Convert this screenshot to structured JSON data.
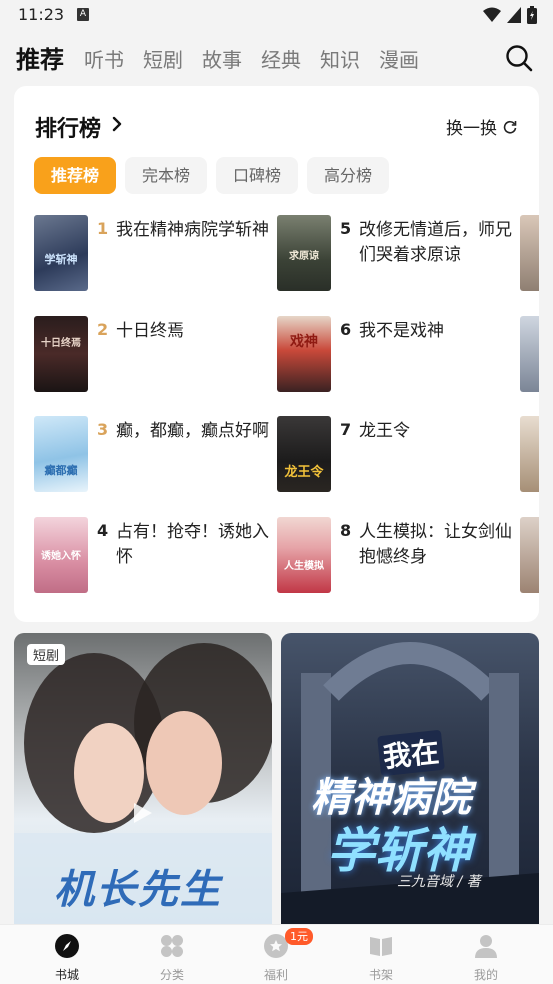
{
  "status_bar": {
    "time": "11:23",
    "notif_glyph": "A"
  },
  "top_tabs": [
    "推荐",
    "听书",
    "短剧",
    "故事",
    "经典",
    "知识",
    "漫画"
  ],
  "ranking": {
    "title": "排行榜",
    "refresh_label": "换一换",
    "chips": [
      "推荐榜",
      "完本榜",
      "口碑榜",
      "高分榜"
    ],
    "books": [
      {
        "rank": "1",
        "name": "我在精神病院学斩神"
      },
      {
        "rank": "2",
        "name": "十日终焉"
      },
      {
        "rank": "3",
        "name": "癫，都癫，癫点好啊"
      },
      {
        "rank": "4",
        "name": "占有！抢夺！诱她入怀"
      },
      {
        "rank": "5",
        "name": "改修无情道后，师兄们哭着求原谅"
      },
      {
        "rank": "6",
        "name": "我不是戏神"
      },
      {
        "rank": "7",
        "name": "龙王令"
      },
      {
        "rank": "8",
        "name": "人生模拟：让女剑仙抱憾终身"
      }
    ],
    "covers": [
      {
        "text": "学斩神",
        "color": "#3c4e73"
      },
      {
        "text": "十日终焉",
        "color": "#3a2222"
      },
      {
        "text": "癫都癫",
        "color": "#a8d4ef"
      },
      {
        "text": "诱她入怀",
        "color": "#e7a6b6"
      },
      {
        "text": "求原谅",
        "color": "#4f5a4a"
      },
      {
        "text": "戏神",
        "color": "#c33a2a"
      },
      {
        "text": "龙王令",
        "color": "#2c2a2a"
      },
      {
        "text": "人生模拟",
        "color": "#c83744"
      }
    ]
  },
  "feed": {
    "left": {
      "tag": "短剧",
      "title": "机长先生"
    },
    "right": {
      "line1": "我在",
      "line2": "精神病院",
      "line3": "学斩神",
      "author": "三九音域 / 著"
    }
  },
  "bottom_nav": [
    {
      "label": "书城",
      "icon": "compass-icon",
      "active": true
    },
    {
      "label": "分类",
      "icon": "grid-icon",
      "active": false
    },
    {
      "label": "福利",
      "icon": "gift-icon",
      "active": false
    },
    {
      "label": "书架",
      "icon": "book-icon",
      "active": false
    },
    {
      "label": "我的",
      "icon": "user-icon",
      "active": false
    }
  ],
  "welfare_badge": "1元",
  "colors": {
    "accent": "#f9a11b",
    "badge": "#ff5a2a"
  }
}
